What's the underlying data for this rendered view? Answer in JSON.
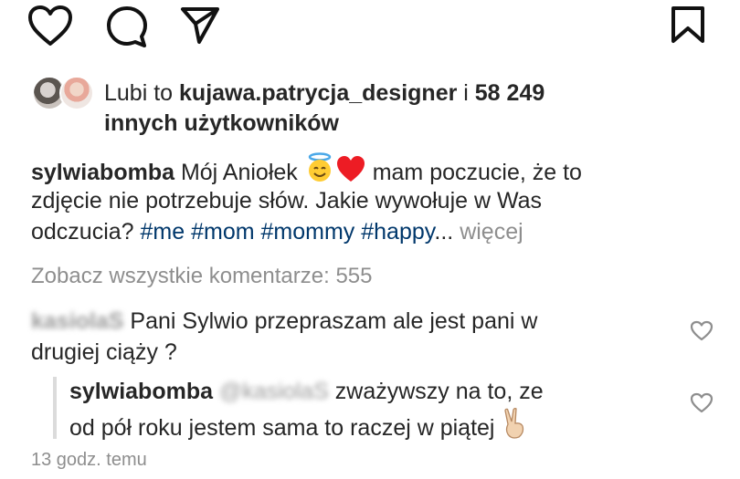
{
  "actions": {
    "like_icon": "heart-outline",
    "comment_icon": "speech-bubble-outline",
    "share_icon": "paper-plane-outline",
    "save_icon": "bookmark-outline"
  },
  "likes": {
    "prefix": "Lubi to ",
    "user": "kujawa.patrycja_designer",
    "middle": " i ",
    "count": "58 249",
    "suffix": "innych użytkowników"
  },
  "caption": {
    "username": "sylwiabomba",
    "text_before_emoji": " Mój Aniołek ",
    "emojis": [
      "😇",
      "❤️"
    ],
    "text_line1_end": " mam poczucie, że to",
    "line2": "zdjęcie nie potrzebuje słów. Jakie wywołuje w Was",
    "line3_start": "odczucia?  ",
    "hashtags": "#me #mom #mommy #happy",
    "ellipsis": "...",
    "more": " więcej"
  },
  "view_all_comments": "Zobacz wszystkie komentarze: 555",
  "comments": [
    {
      "username": "kasiolaS",
      "line1": "Pani Sylwio przepraszam ale jest pani w",
      "line2": "drugiej ciąży ?"
    }
  ],
  "reply": {
    "username": "sylwiabomba",
    "mention": "@kasiolaS",
    "line1_end": " zważywszy na to, ze",
    "line2": "od pół roku jestem sama to raczej w piątej ",
    "emoji": "✌️"
  },
  "timestamp": "13 godz. temu",
  "colors": {
    "text": "#262626",
    "hashtag": "#00376b",
    "muted": "#8e8e8e",
    "heart_red": "#ed1c24"
  }
}
